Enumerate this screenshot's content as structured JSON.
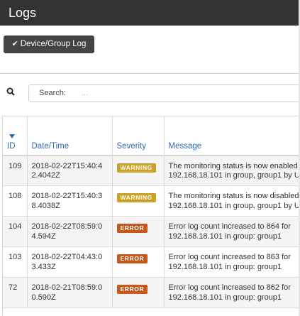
{
  "app": {
    "title": "Logs"
  },
  "tabs": [
    {
      "label": "Device/Group Log",
      "icon": "check-icon",
      "active": true
    }
  ],
  "search": {
    "label": "Search:",
    "placeholder": "..."
  },
  "table": {
    "columns": {
      "id": "ID",
      "datetime": "Date/Time",
      "severity": "Severity",
      "message": "Message"
    },
    "sort": {
      "column": "ID",
      "direction": "descending"
    },
    "rows": [
      {
        "id": "109",
        "datetime": "2018-02-22T15:40:42.4042Z",
        "severity": "WARNING",
        "message_line1": "The monitoring status is now enabled",
        "message_line2": "192.168.18.101 in group, group1 by U"
      },
      {
        "id": "108",
        "datetime": "2018-02-22T15:40:38.4038Z",
        "severity": "WARNING",
        "message_line1": "The monitoring status is now disabled",
        "message_line2": "192.168.18.101 in group, group1 by U"
      },
      {
        "id": "104",
        "datetime": "2018-02-22T08:59:04.594Z",
        "severity": "ERROR",
        "message_line1": "Error log count increased to 864 for",
        "message_line2": "192.168.18.101 in group: group1"
      },
      {
        "id": "103",
        "datetime": "2018-02-22T04:43:03.433Z",
        "severity": "ERROR",
        "message_line1": "Error log count increased to 863 for",
        "message_line2": "192.168.18.101 in group: group1"
      },
      {
        "id": "72",
        "datetime": "2018-02-21T08:59:00.590Z",
        "severity": "ERROR",
        "message_line1": "Error log count increased to 862 for",
        "message_line2": "192.168.18.101 in group: group1"
      }
    ]
  },
  "colors": {
    "titlebar": "#333333",
    "tab_active": "#444444",
    "header_text": "#2d6bb5",
    "warning": "#c9a227",
    "error": "#c8571b"
  }
}
